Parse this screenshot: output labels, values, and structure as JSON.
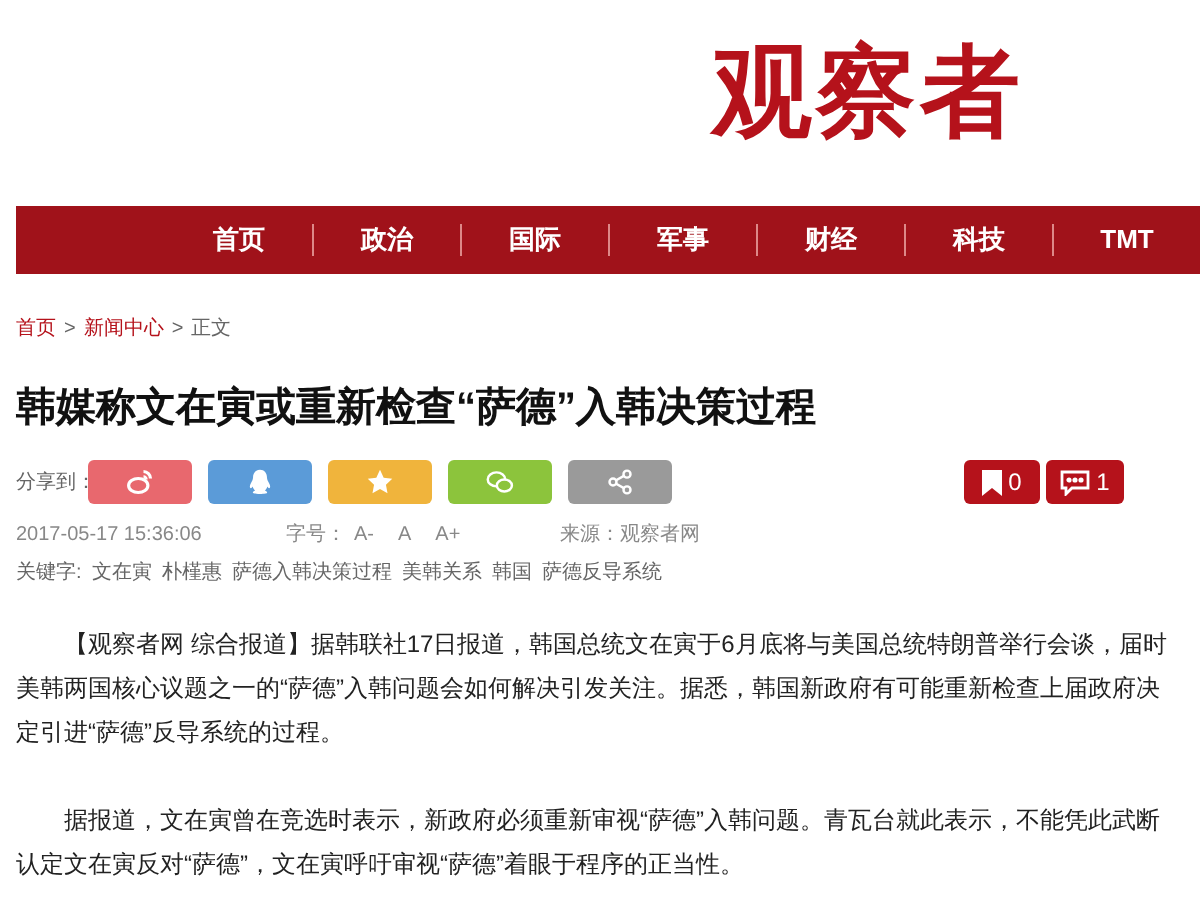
{
  "logo": "观察者",
  "nav": [
    {
      "label": "首页"
    },
    {
      "label": "政治"
    },
    {
      "label": "国际"
    },
    {
      "label": "军事"
    },
    {
      "label": "财经"
    },
    {
      "label": "科技"
    },
    {
      "label": "TMT"
    }
  ],
  "breadcrumb": [
    {
      "label": "首页",
      "link": true
    },
    {
      "label": ">",
      "link": false
    },
    {
      "label": "新闻中心",
      "link": true
    },
    {
      "label": ">",
      "link": false
    },
    {
      "label": "正文",
      "link": false
    }
  ],
  "title": "韩媒称文在寅或重新检查“萨德”入韩决策过程",
  "share": {
    "label": "分享到：",
    "buttons": [
      {
        "kind": "weibo",
        "color": "#e8686e"
      },
      {
        "kind": "qq",
        "color": "#5b9bd8"
      },
      {
        "kind": "favorite",
        "color": "#f0b43c"
      },
      {
        "kind": "wechat",
        "color": "#8cc43c"
      },
      {
        "kind": "more",
        "color": "#9a9a9a"
      }
    ]
  },
  "counters": [
    {
      "kind": "bookmark",
      "count": "0"
    },
    {
      "kind": "comment",
      "count": "1"
    }
  ],
  "meta": {
    "date": "2017-05-17 15:36:06",
    "font_size_label": "字号：",
    "font_sizes": [
      "A-",
      "A",
      "A+"
    ],
    "source": "来源：观察者网"
  },
  "keywords": {
    "label": "关键字:",
    "items": [
      "文在寅",
      "朴槿惠",
      "萨德入韩决策过程",
      "美韩关系",
      "韩国",
      "萨德反导系统"
    ]
  },
  "paragraphs": [
    "【观察者网 综合报道】据韩联社17日报道，韩国总统文在寅于6月底将与美国总统特朗普举行会谈，届时美韩两国核心议题之一的“萨德”入韩问题会如何解决引发关注。据悉，韩国新政府有可能重新检查上届政府决定引进“萨德”反导系统的过程。",
    "据报道，文在寅曾在竞选时表示，新政府必须重新审视“萨德”入韩问题。青瓦台就此表示，不能凭此武断认定文在寅反对“萨德”，文在寅呼吁审视“萨德”着眼于程序的正当性。"
  ]
}
